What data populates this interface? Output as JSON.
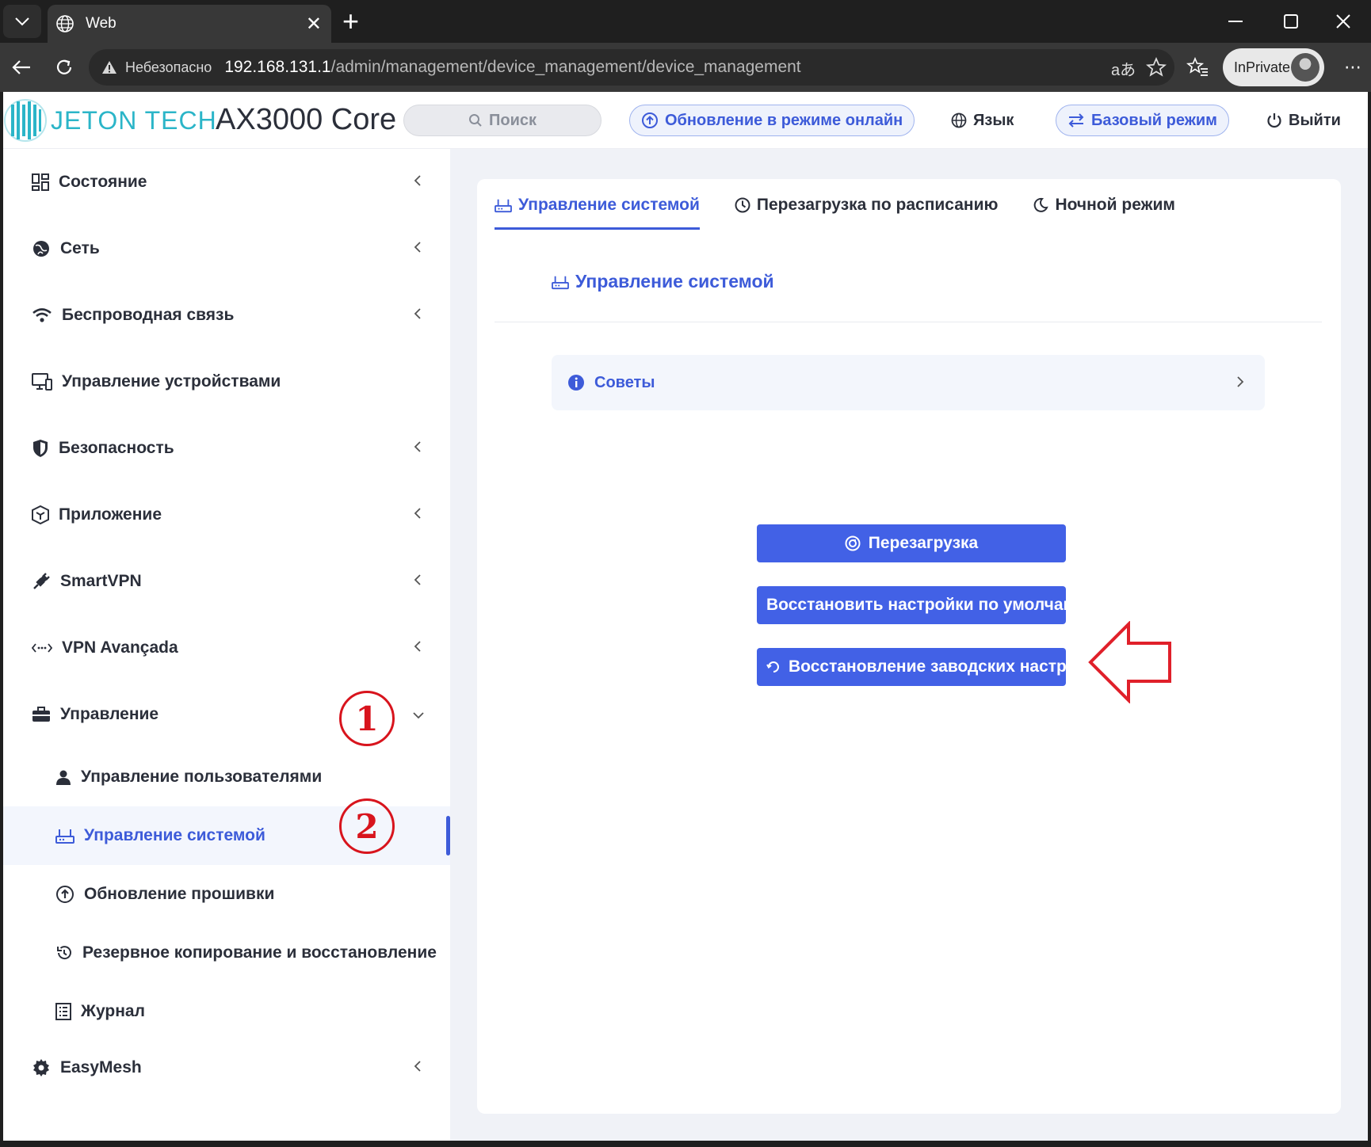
{
  "browser": {
    "tab_title": "Web",
    "address_warning": "Небезопасно",
    "address_host": "192.168.131.1",
    "address_path": "/admin/management/device_management/device_management",
    "inprivate_label": "InPrivate"
  },
  "header": {
    "brand": "JETON TECH",
    "model": "AX3000 Core",
    "search_placeholder": "Поиск",
    "online_update": "Обновление в режиме онлайн",
    "language": "Язык",
    "basic_mode": "Базовый режим",
    "logout": "Выйти"
  },
  "sidebar": {
    "items": [
      {
        "label": "Состояние",
        "icon": "dashboard-icon"
      },
      {
        "label": "Сеть",
        "icon": "globe-network-icon"
      },
      {
        "label": "Беспроводная связь",
        "icon": "wifi-icon"
      },
      {
        "label": "Управление устройствами",
        "icon": "devices-icon"
      },
      {
        "label": "Безопасность",
        "icon": "shield-icon"
      },
      {
        "label": "Приложение",
        "icon": "cube-icon"
      },
      {
        "label": "SmartVPN",
        "icon": "plug-icon"
      },
      {
        "label": "VPN Avançada",
        "icon": "dots-arrows-icon"
      },
      {
        "label": "Управление",
        "icon": "toolbox-icon"
      },
      {
        "label": "EasyMesh",
        "icon": "gear-icon"
      }
    ],
    "sub_items": [
      {
        "label": "Управление пользователями",
        "icon": "user-icon"
      },
      {
        "label": "Управление системой",
        "icon": "router-icon"
      },
      {
        "label": "Обновление прошивки",
        "icon": "upload-circle-icon"
      },
      {
        "label": "Резервное копирование и восстановление",
        "icon": "restore-icon"
      },
      {
        "label": "Журнал",
        "icon": "log-icon"
      }
    ],
    "annotations": [
      "1",
      "2"
    ]
  },
  "main": {
    "tabs": [
      {
        "label": "Управление системой",
        "active": true
      },
      {
        "label": "Перезагрузка по расписанию",
        "active": false
      },
      {
        "label": "Ночной режим",
        "active": false
      }
    ],
    "section_title": "Управление системой",
    "tips_label": "Советы",
    "buttons": {
      "reboot": "Перезагрузка",
      "restore_defaults": "Восстановить настройки по умолчанию",
      "factory_reset": "Восстановление заводских настроек"
    }
  },
  "colors": {
    "accent": "#3d5bd9",
    "button": "#4261e6",
    "annotation_red": "#d8141d",
    "brand_teal": "#2bb5c8"
  }
}
